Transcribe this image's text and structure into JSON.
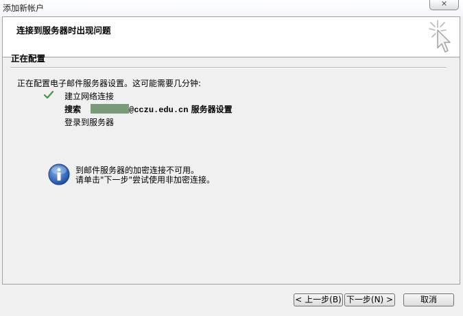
{
  "window": {
    "title": "添加新帐户",
    "close_label": "✕"
  },
  "header": {
    "title": "连接到服务器时出现问题",
    "icon": "wizard-cursor-icon"
  },
  "section": {
    "title": "正在配置",
    "description": "正在配置电子邮件服务器设置。这可能需要几分钟:"
  },
  "steps": {
    "connect": {
      "label": "建立网络连接",
      "status": "done",
      "icon": "checkmark-icon",
      "color": "#3a9a3a"
    },
    "search": {
      "prefix": "搜索",
      "redacted_color": "#7a9a7a",
      "domain": "@cczu.edu.cn",
      "suffix": "服务器设置"
    },
    "login": {
      "label": "登录到服务器"
    }
  },
  "info": {
    "icon": "info-icon",
    "line1": "到邮件服务器的加密连接不可用。",
    "line2": "请单击\"下一步\"尝试使用非加密连接。"
  },
  "buttons": {
    "back": "< 上一步(B)",
    "next": "下一步(N) >",
    "cancel": "取消"
  }
}
